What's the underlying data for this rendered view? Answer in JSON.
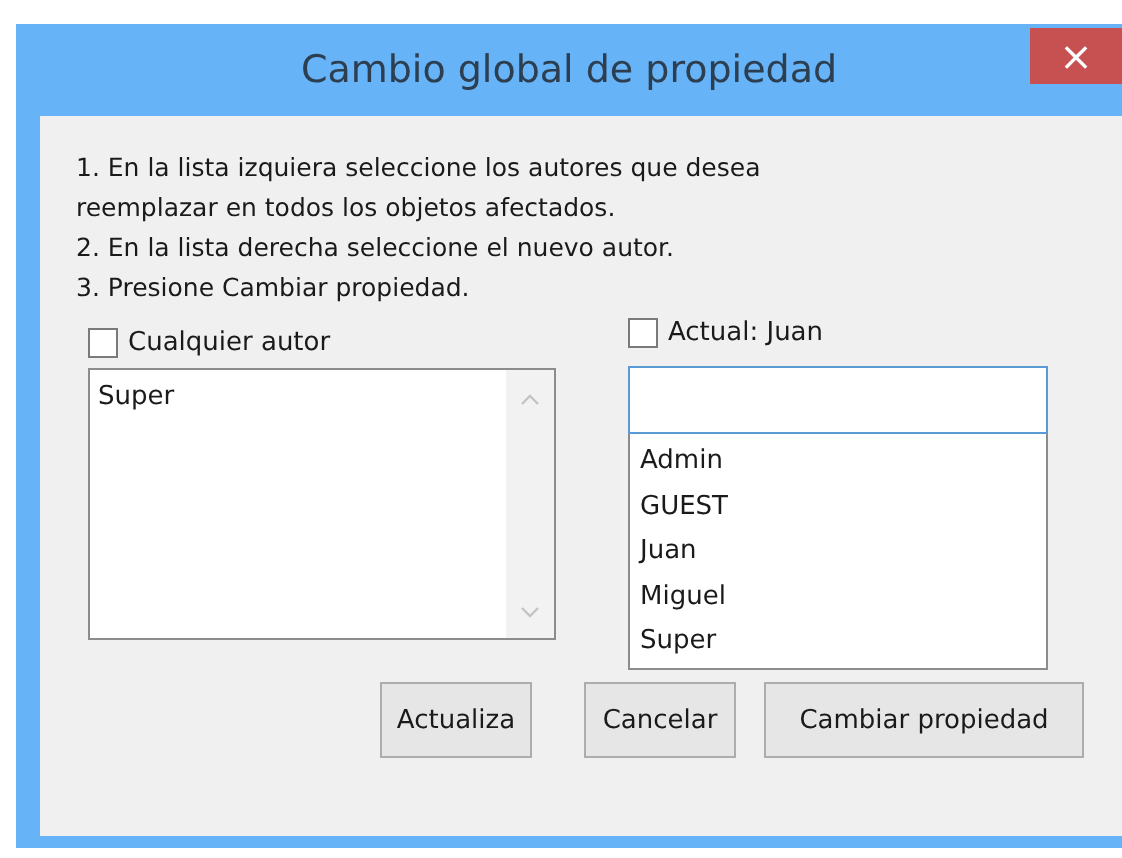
{
  "window": {
    "title": "Cambio global de propiedad",
    "close": "×"
  },
  "instructions": [
    "1. En la lista izquiera seleccione los autores que desea",
    "reemplazar en todos los objetos afectados.",
    "2. En la lista derecha seleccione el nuevo autor.",
    "3. Presione Cambiar propiedad."
  ],
  "left": {
    "checkbox": {
      "label": "Cualquier autor",
      "checked": false
    },
    "items": [
      "Super"
    ]
  },
  "right": {
    "checkbox": {
      "label": "Actual: Juan",
      "checked": false
    },
    "items": [
      "Admin",
      "GUEST",
      "Juan",
      "Miguel",
      "Super"
    ]
  },
  "buttons": [
    "Actualiza",
    "Cancelar",
    "Cambiar propiedad"
  ]
}
